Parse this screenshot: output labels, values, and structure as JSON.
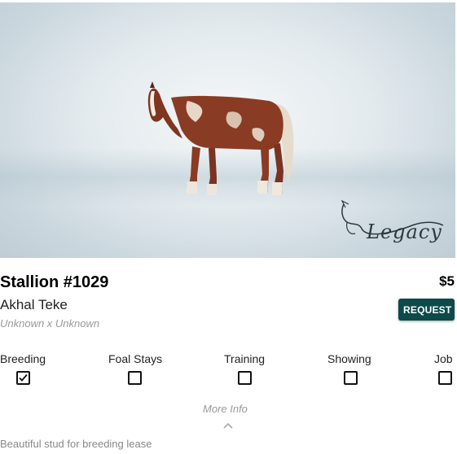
{
  "listing": {
    "title": "Stallion #1029",
    "price": "$5",
    "breed": "Akhal Teke",
    "lineage": "Unknown x Unknown",
    "request_label": "REQUEST",
    "description": "Beautiful stud for breeding lease"
  },
  "photo": {
    "brand_text": "Legacy",
    "icon": "horse-image"
  },
  "options": [
    {
      "label": "Breeding",
      "checked": true
    },
    {
      "label": "Foal Stays",
      "checked": false
    },
    {
      "label": "Training",
      "checked": false
    },
    {
      "label": "Showing",
      "checked": false
    },
    {
      "label": "Job",
      "checked": false
    }
  ],
  "more_info": {
    "label": "More Info",
    "icon": "chevron-up-icon"
  },
  "colors": {
    "accent": "#0d4a4a"
  }
}
